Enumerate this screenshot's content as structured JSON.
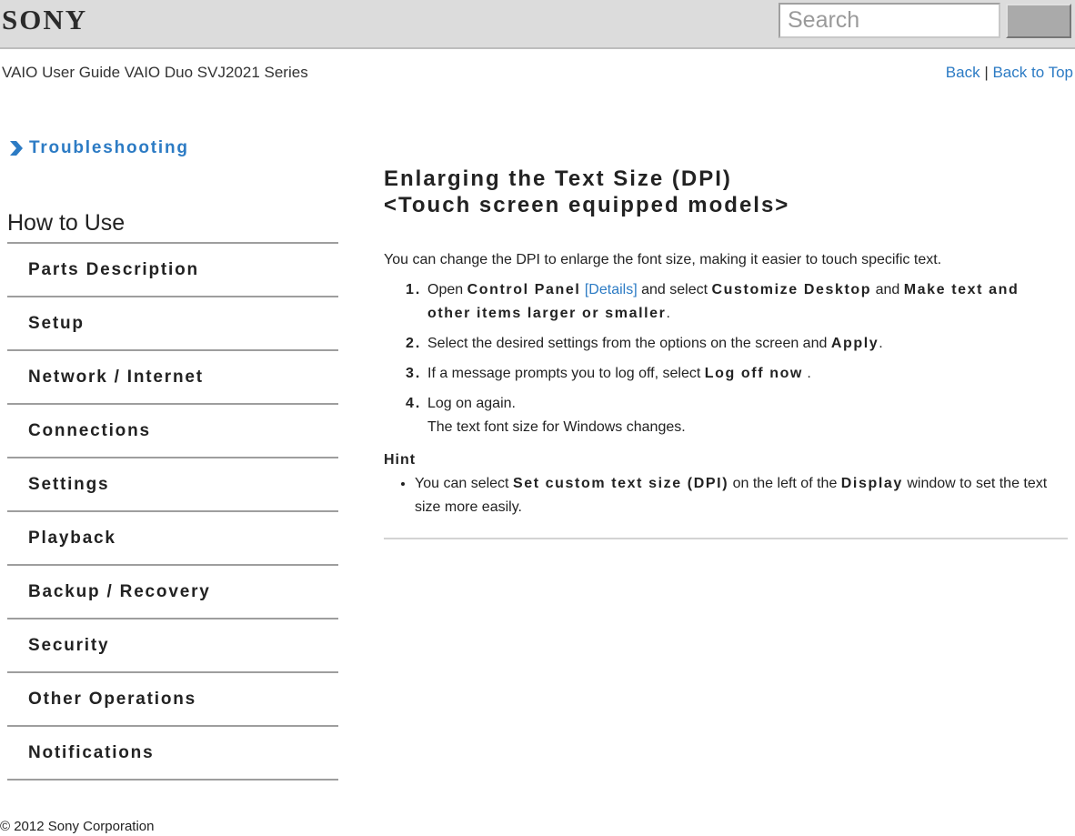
{
  "header": {
    "logo": "SONY",
    "search": {
      "placeholder": "Search",
      "value": ""
    },
    "guide_title": "VAIO User Guide VAIO Duo SVJ2021 Series",
    "links": {
      "back": "Back",
      "separator": " | ",
      "back_to_top": "Back to Top"
    }
  },
  "sidebar": {
    "section_link": {
      "icon": "chevron-right-icon",
      "label": "Troubleshooting"
    },
    "heading": "How to Use",
    "items": [
      {
        "label": "Parts Description"
      },
      {
        "label": "Setup"
      },
      {
        "label": "Network / Internet"
      },
      {
        "label": "Connections"
      },
      {
        "label": "Settings"
      },
      {
        "label": "Playback"
      },
      {
        "label": "Backup / Recovery"
      },
      {
        "label": "Security"
      },
      {
        "label": "Other Operations"
      },
      {
        "label": "Notifications"
      }
    ]
  },
  "main": {
    "title_line1": "Enlarging the Text Size (DPI)",
    "title_line2": "<Touch screen equipped models>",
    "intro": "You can change the DPI to enlarge the font size, making it easier to touch specific text.",
    "steps": [
      {
        "num": "1.",
        "t1": "Open ",
        "b1": "Control Panel",
        "link": "[Details]",
        "t2": " and select ",
        "b2": "Customize Desktop",
        "t3": " and ",
        "b3": "Make text and other items larger or smaller",
        "t4": "."
      },
      {
        "num": "2.",
        "t1": "Select the desired settings from the options on the screen and ",
        "b1": "Apply",
        "t2": "."
      },
      {
        "num": "3.",
        "t1": "If a message prompts you to log off, select ",
        "b1": "Log off now",
        "t2": " ."
      },
      {
        "num": "4.",
        "t1": "Log on again.",
        "t2": "The text font size for Windows changes."
      }
    ],
    "hint": {
      "label": "Hint",
      "t1": "You can select ",
      "b1": "Set custom text size (DPI)",
      "t2": " on the left of the ",
      "b2": "Display",
      "t3": " window to set the text size more easily."
    }
  },
  "footer": {
    "copyright": "© 2012 Sony Corporation"
  },
  "colors": {
    "link": "#2c7bc4",
    "topbar": "#dcdcdc",
    "divider": "#9e9e9e"
  }
}
